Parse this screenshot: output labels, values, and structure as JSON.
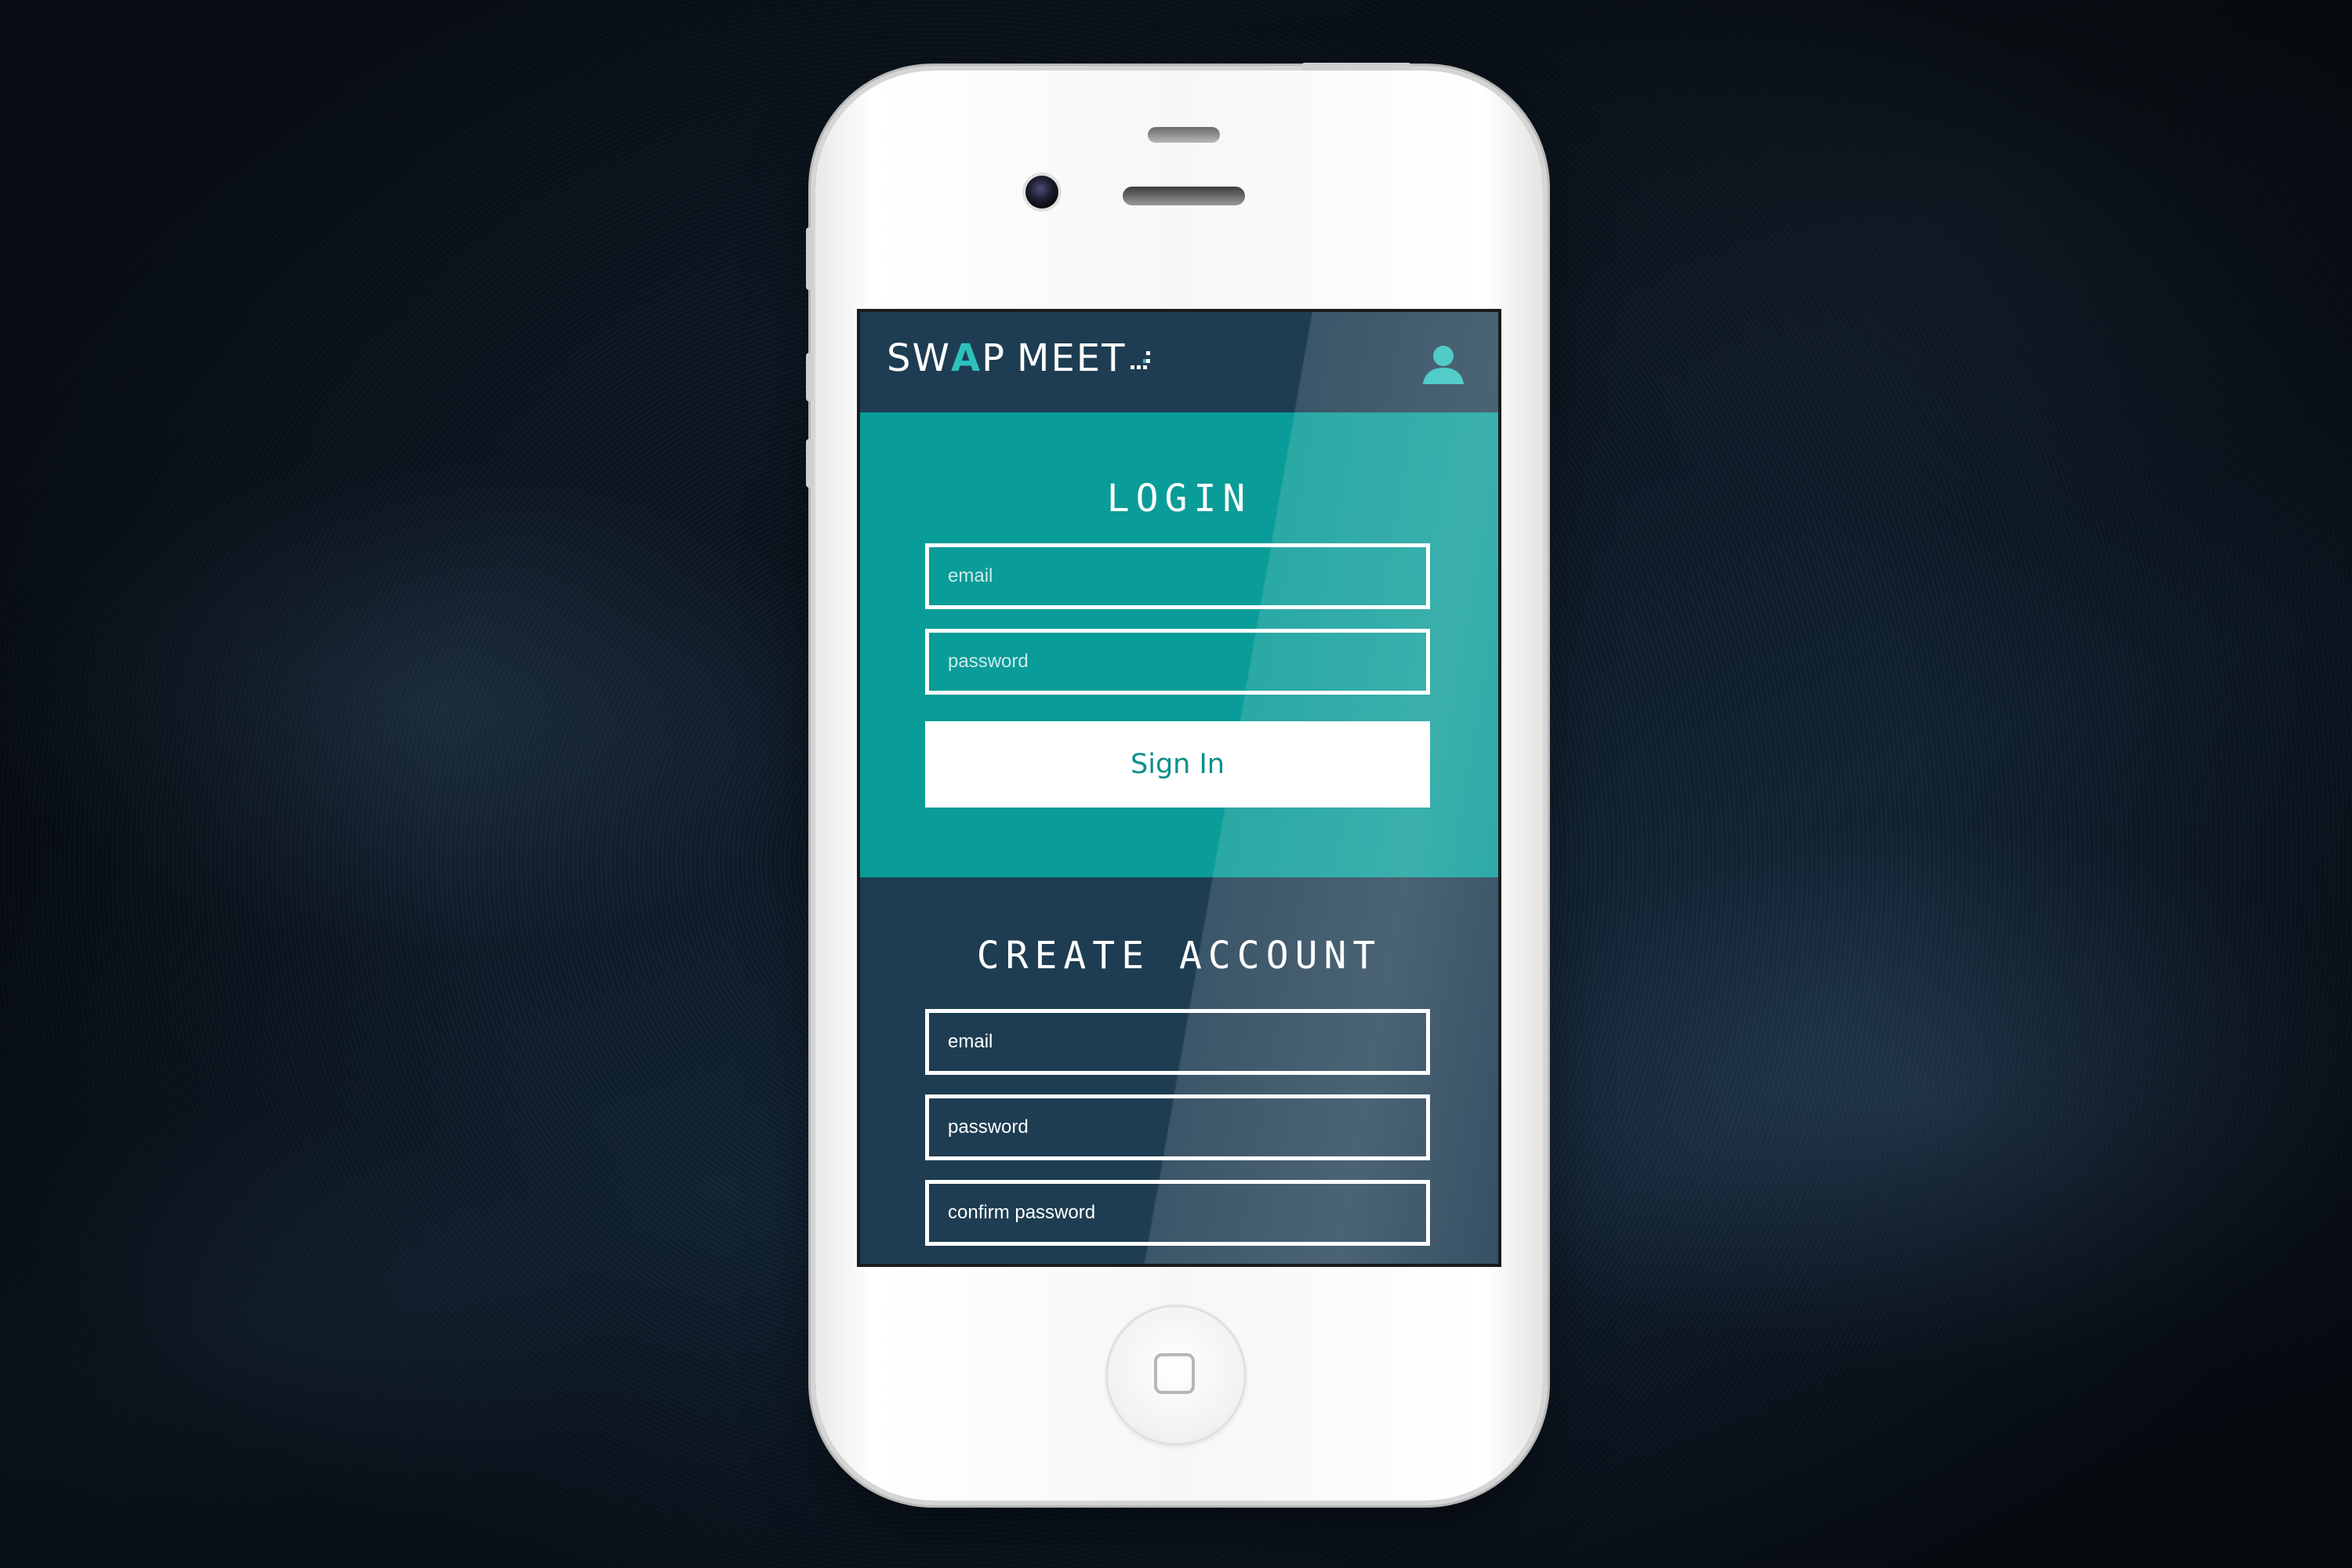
{
  "app": {
    "logo": {
      "part1": "SW",
      "accent": "A",
      "part2": "P",
      "part3": "MEET"
    },
    "user_icon": "user-icon"
  },
  "login": {
    "title": "LOGIN",
    "email_placeholder": "email",
    "password_placeholder": "password",
    "signin_label": "Sign In"
  },
  "create_account": {
    "title": "CREATE ACCOUNT",
    "email_placeholder": "email",
    "password_placeholder": "password",
    "confirm_placeholder": "confirm password"
  },
  "colors": {
    "header_bg": "#1e3d52",
    "login_bg": "#0a9c98",
    "accent": "#2cc1bd",
    "button_text": "#0b8f8c"
  },
  "icons": [
    "user-icon",
    "home-button-icon",
    "camera-icon",
    "speaker-icon"
  ]
}
